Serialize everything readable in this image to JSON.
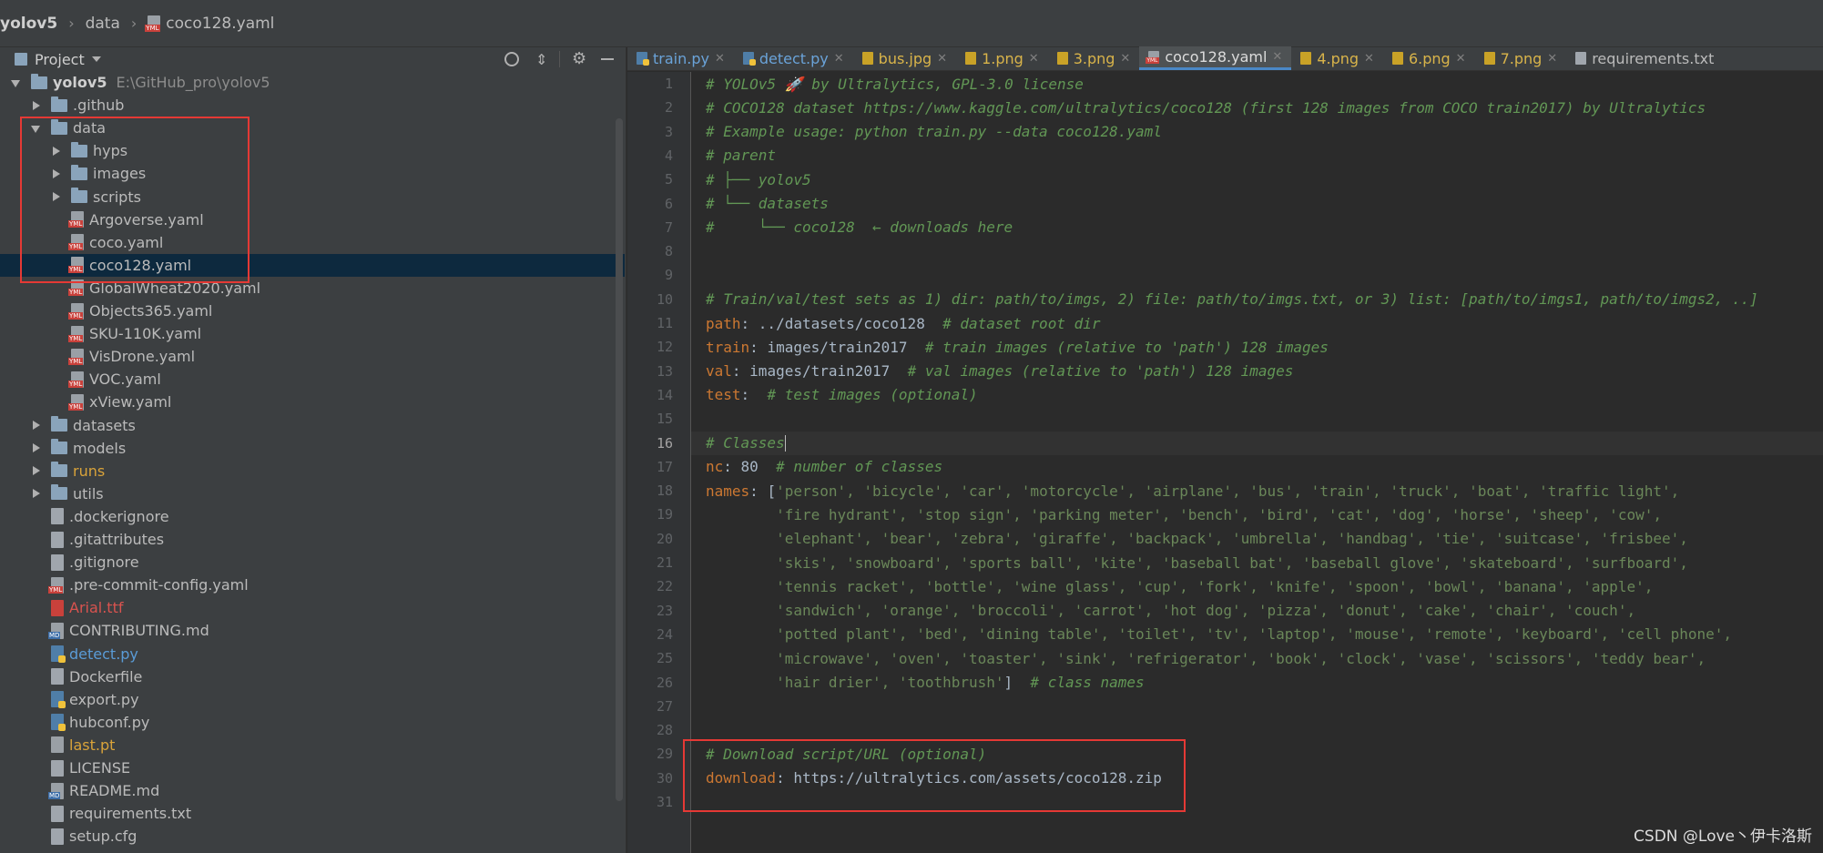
{
  "breadcrumb": {
    "items": [
      "yolov5",
      "data",
      "coco128.yaml"
    ]
  },
  "project_panel": {
    "title": "Project",
    "toolbar_icons": [
      "target-icon",
      "collapse-icon",
      "gear-icon",
      "minimize-icon"
    ],
    "tree": [
      {
        "label": "yolov5",
        "extra": "E:\\GitHub_pro\\yolov5",
        "type": "folder",
        "expanded": true,
        "depth": 0,
        "bold": true
      },
      {
        "label": ".github",
        "type": "folder",
        "expanded": false,
        "depth": 1
      },
      {
        "label": "data",
        "type": "folder",
        "expanded": true,
        "depth": 1
      },
      {
        "label": "hyps",
        "type": "folder",
        "expanded": false,
        "depth": 2
      },
      {
        "label": "images",
        "type": "folder",
        "expanded": false,
        "depth": 2
      },
      {
        "label": "scripts",
        "type": "folder",
        "expanded": false,
        "depth": 2
      },
      {
        "label": "Argoverse.yaml",
        "type": "yaml",
        "depth": 2
      },
      {
        "label": "coco.yaml",
        "type": "yaml",
        "depth": 2
      },
      {
        "label": "coco128.yaml",
        "type": "yaml",
        "depth": 2,
        "selected": true
      },
      {
        "label": "GlobalWheat2020.yaml",
        "type": "yaml",
        "depth": 2
      },
      {
        "label": "Objects365.yaml",
        "type": "yaml",
        "depth": 2
      },
      {
        "label": "SKU-110K.yaml",
        "type": "yaml",
        "depth": 2
      },
      {
        "label": "VisDrone.yaml",
        "type": "yaml",
        "depth": 2
      },
      {
        "label": "VOC.yaml",
        "type": "yaml",
        "depth": 2
      },
      {
        "label": "xView.yaml",
        "type": "yaml",
        "depth": 2
      },
      {
        "label": "datasets",
        "type": "folder",
        "expanded": false,
        "depth": 1
      },
      {
        "label": "models",
        "type": "folder",
        "expanded": false,
        "depth": 1
      },
      {
        "label": "runs",
        "type": "folder",
        "expanded": false,
        "depth": 1,
        "color": "orange"
      },
      {
        "label": "utils",
        "type": "folder",
        "expanded": false,
        "depth": 1
      },
      {
        "label": ".dockerignore",
        "type": "txt",
        "depth": 1
      },
      {
        "label": ".gitattributes",
        "type": "txt",
        "depth": 1
      },
      {
        "label": ".gitignore",
        "type": "txt",
        "depth": 1
      },
      {
        "label": ".pre-commit-config.yaml",
        "type": "yaml",
        "depth": 1
      },
      {
        "label": "Arial.ttf",
        "type": "ttf",
        "depth": 1,
        "color": "red"
      },
      {
        "label": "CONTRIBUTING.md",
        "type": "md",
        "depth": 1
      },
      {
        "label": "detect.py",
        "type": "py",
        "depth": 1,
        "color": "blue"
      },
      {
        "label": "Dockerfile",
        "type": "txt",
        "depth": 1
      },
      {
        "label": "export.py",
        "type": "py",
        "depth": 1
      },
      {
        "label": "hubconf.py",
        "type": "py",
        "depth": 1
      },
      {
        "label": "last.pt",
        "type": "pt",
        "depth": 1,
        "color": "orange"
      },
      {
        "label": "LICENSE",
        "type": "txt",
        "depth": 1
      },
      {
        "label": "README.md",
        "type": "md",
        "depth": 1
      },
      {
        "label": "requirements.txt",
        "type": "txt",
        "depth": 1
      },
      {
        "label": "setup.cfg",
        "type": "txt",
        "depth": 1
      }
    ]
  },
  "editor": {
    "tabs": [
      {
        "label": "train.py",
        "icon": "py"
      },
      {
        "label": "detect.py",
        "icon": "py"
      },
      {
        "label": "bus.jpg",
        "icon": "img"
      },
      {
        "label": "1.png",
        "icon": "img"
      },
      {
        "label": "3.png",
        "icon": "img"
      },
      {
        "label": "coco128.yaml",
        "icon": "yaml",
        "active": true
      },
      {
        "label": "4.png",
        "icon": "img"
      },
      {
        "label": "6.png",
        "icon": "img"
      },
      {
        "label": "7.png",
        "icon": "img"
      },
      {
        "label": "requirements.txt",
        "icon": "txt"
      }
    ],
    "current_line": 16,
    "lines": [
      [
        {
          "t": "# YOLOv5 🚀 by Ultralytics, GPL-3.0 license",
          "c": "comment"
        }
      ],
      [
        {
          "t": "# COCO128 dataset https://www.kaggle.com/ultralytics/coco128 (first 128 images from COCO train2017) by Ultralytics",
          "c": "comment"
        }
      ],
      [
        {
          "t": "# Example usage: python train.py --data coco128.yaml",
          "c": "comment"
        }
      ],
      [
        {
          "t": "# parent",
          "c": "comment"
        }
      ],
      [
        {
          "t": "# ├── yolov5",
          "c": "comment"
        }
      ],
      [
        {
          "t": "# └── datasets",
          "c": "comment"
        }
      ],
      [
        {
          "t": "#     └── coco128  ← downloads here",
          "c": "comment"
        }
      ],
      [],
      [],
      [
        {
          "t": "# Train/val/test sets as 1) dir: path/to/imgs, 2) file: path/to/imgs.txt, or 3) list: [path/to/imgs1, path/to/imgs2, ..]",
          "c": "comment"
        }
      ],
      [
        {
          "t": "path",
          "c": "key"
        },
        {
          "t": ": ../datasets/coco128  ",
          "c": "val"
        },
        {
          "t": "# dataset root dir",
          "c": "comment"
        }
      ],
      [
        {
          "t": "train",
          "c": "key"
        },
        {
          "t": ": images/train2017  ",
          "c": "val"
        },
        {
          "t": "# train images (relative to 'path') 128 images",
          "c": "comment"
        }
      ],
      [
        {
          "t": "val",
          "c": "key"
        },
        {
          "t": ": images/train2017  ",
          "c": "val"
        },
        {
          "t": "# val images (relative to 'path') 128 images",
          "c": "comment"
        }
      ],
      [
        {
          "t": "test",
          "c": "key"
        },
        {
          "t": ":  ",
          "c": "val"
        },
        {
          "t": "# test images (optional)",
          "c": "comment"
        }
      ],
      [],
      [
        {
          "t": "# Classes",
          "c": "comment"
        }
      ],
      [
        {
          "t": "nc",
          "c": "key"
        },
        {
          "t": ": 80  ",
          "c": "val"
        },
        {
          "t": "# number of classes",
          "c": "comment"
        }
      ],
      [
        {
          "t": "names",
          "c": "key"
        },
        {
          "t": ": [",
          "c": "val"
        },
        {
          "t": "'person', 'bicycle', 'car', 'motorcycle', 'airplane', 'bus', 'train', 'truck', 'boat', 'traffic light',",
          "c": "str"
        }
      ],
      [
        {
          "t": "        'fire hydrant', 'stop sign', 'parking meter', 'bench', 'bird', 'cat', 'dog', 'horse', 'sheep', 'cow',",
          "c": "str"
        }
      ],
      [
        {
          "t": "        'elephant', 'bear', 'zebra', 'giraffe', 'backpack', 'umbrella', 'handbag', 'tie', 'suitcase', 'frisbee',",
          "c": "str"
        }
      ],
      [
        {
          "t": "        'skis', 'snowboard', 'sports ball', 'kite', 'baseball bat', 'baseball glove', 'skateboard', 'surfboard',",
          "c": "str"
        }
      ],
      [
        {
          "t": "        'tennis racket', 'bottle', 'wine glass', 'cup', 'fork', 'knife', 'spoon', 'bowl', 'banana', 'apple',",
          "c": "str"
        }
      ],
      [
        {
          "t": "        'sandwich', 'orange', 'broccoli', 'carrot', 'hot dog', 'pizza', 'donut', 'cake', 'chair', 'couch',",
          "c": "str"
        }
      ],
      [
        {
          "t": "        'potted plant', 'bed', 'dining table', 'toilet', 'tv', 'laptop', 'mouse', 'remote', 'keyboard', 'cell phone',",
          "c": "str"
        }
      ],
      [
        {
          "t": "        'microwave', 'oven', 'toaster', 'sink', 'refrigerator', 'book', 'clock', 'vase', 'scissors', 'teddy bear',",
          "c": "str"
        }
      ],
      [
        {
          "t": "        'hair drier', 'toothbrush'",
          "c": "str"
        },
        {
          "t": "]  ",
          "c": "val"
        },
        {
          "t": "# class names",
          "c": "comment"
        }
      ],
      [],
      [],
      [
        {
          "t": "# Download script/URL (optional)",
          "c": "comment"
        }
      ],
      [
        {
          "t": "download",
          "c": "key"
        },
        {
          "t": ": https://ultralytics.com/assets/coco128.zip",
          "c": "val"
        }
      ],
      []
    ]
  },
  "watermark": "CSDN @Love丶伊卡洛斯",
  "colors": {
    "highlight_box": "#e53935",
    "comment": "#629755",
    "key": "#cc7832",
    "string": "#6a8759",
    "selection": "#0d293e",
    "active_tab_underline": "#4a88c7"
  }
}
